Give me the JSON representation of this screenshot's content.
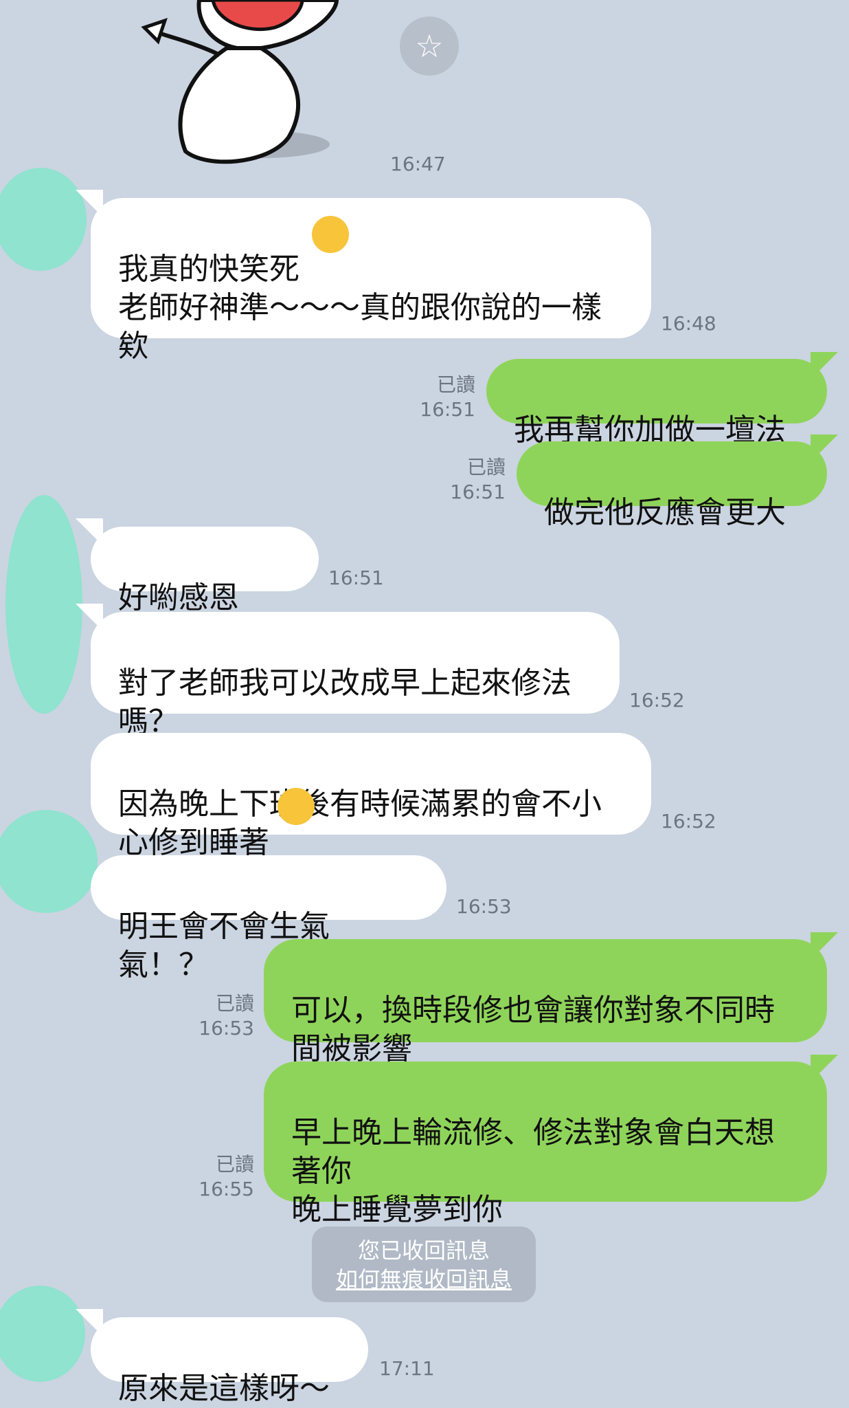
{
  "sticker": {
    "time": "16:47"
  },
  "messages": [
    {
      "id": "m1",
      "dir": "in",
      "text": "我真的快笑死\n老師好神準～～～真的跟你說的一樣\n欸",
      "emoji": "laughing-face-icon",
      "time": "16:48"
    },
    {
      "id": "m2",
      "dir": "out",
      "text": "我再幫你加做一壇法",
      "read": "已讀",
      "time": "16:51"
    },
    {
      "id": "m3",
      "dir": "out",
      "text": "做完他反應會更大",
      "read": "已讀",
      "time": "16:51"
    },
    {
      "id": "m4",
      "dir": "in",
      "text": "好喲感恩",
      "emoji": "pleading-face-icon",
      "time": "16:51"
    },
    {
      "id": "m5",
      "dir": "in",
      "text": "對了老師我可以改成早上起來修法\n嗎？",
      "time": "16:52"
    },
    {
      "id": "m6",
      "dir": "in",
      "text": "因為晚上下班後有時候滿累的會不小\n心修到睡著",
      "emoji": "tears-of-joy-icon",
      "time": "16:52"
    },
    {
      "id": "m7",
      "dir": "in",
      "text": "明王會不會生氣氣！？",
      "time": "16:53"
    },
    {
      "id": "m8",
      "dir": "out",
      "text": "可以，換時段修也會讓你對象不同時\n間被影響",
      "read": "已讀",
      "time": "16:53"
    },
    {
      "id": "m9",
      "dir": "out",
      "text": "早上晚上輪流修、修法對象會白天想\n著你\n晚上睡覺夢到你",
      "read": "已讀",
      "time": "16:55"
    },
    {
      "id": "m10",
      "dir": "in",
      "text": "原來是這樣呀～",
      "time": "17:11"
    }
  ],
  "system_notice": {
    "text": "您已收回訊息",
    "link": "如何無痕收回訊息"
  }
}
